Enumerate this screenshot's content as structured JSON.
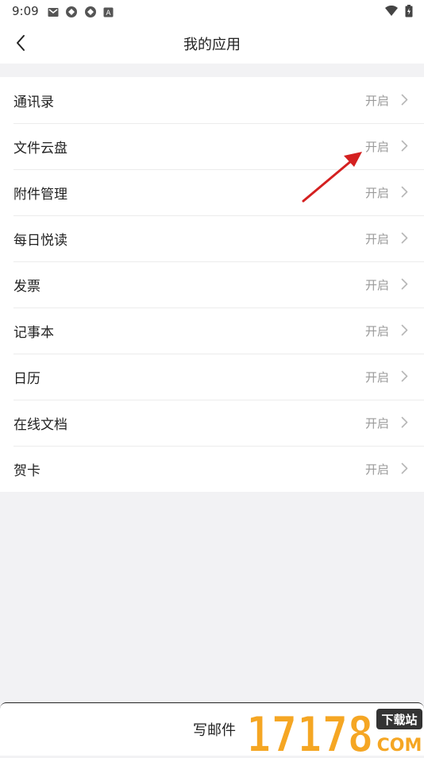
{
  "status_bar": {
    "time": "9:09",
    "notification_icons": [
      "mail-icon",
      "app-icon",
      "app-icon",
      "a-badge-icon"
    ],
    "system_icons": [
      "wifi-icon",
      "battery-icon"
    ]
  },
  "header": {
    "title": "我的应用",
    "back_icon": "chevron-left-icon"
  },
  "apps": [
    {
      "label": "通讯录",
      "status": "开启"
    },
    {
      "label": "文件云盘",
      "status": "开启"
    },
    {
      "label": "附件管理",
      "status": "开启"
    },
    {
      "label": "每日悦读",
      "status": "开启"
    },
    {
      "label": "发票",
      "status": "开启"
    },
    {
      "label": "记事本",
      "status": "开启"
    },
    {
      "label": "日历",
      "status": "开启"
    },
    {
      "label": "在线文档",
      "status": "开启"
    },
    {
      "label": "贺卡",
      "status": "开启"
    }
  ],
  "bottom": {
    "compose_label": "写邮件"
  },
  "watermark": {
    "number": "17178",
    "badge": "下载站",
    "domain": "COM"
  },
  "colors": {
    "background": "#f2f2f4",
    "annotation_arrow": "#d42020",
    "watermark_orange": "#f5a623"
  }
}
